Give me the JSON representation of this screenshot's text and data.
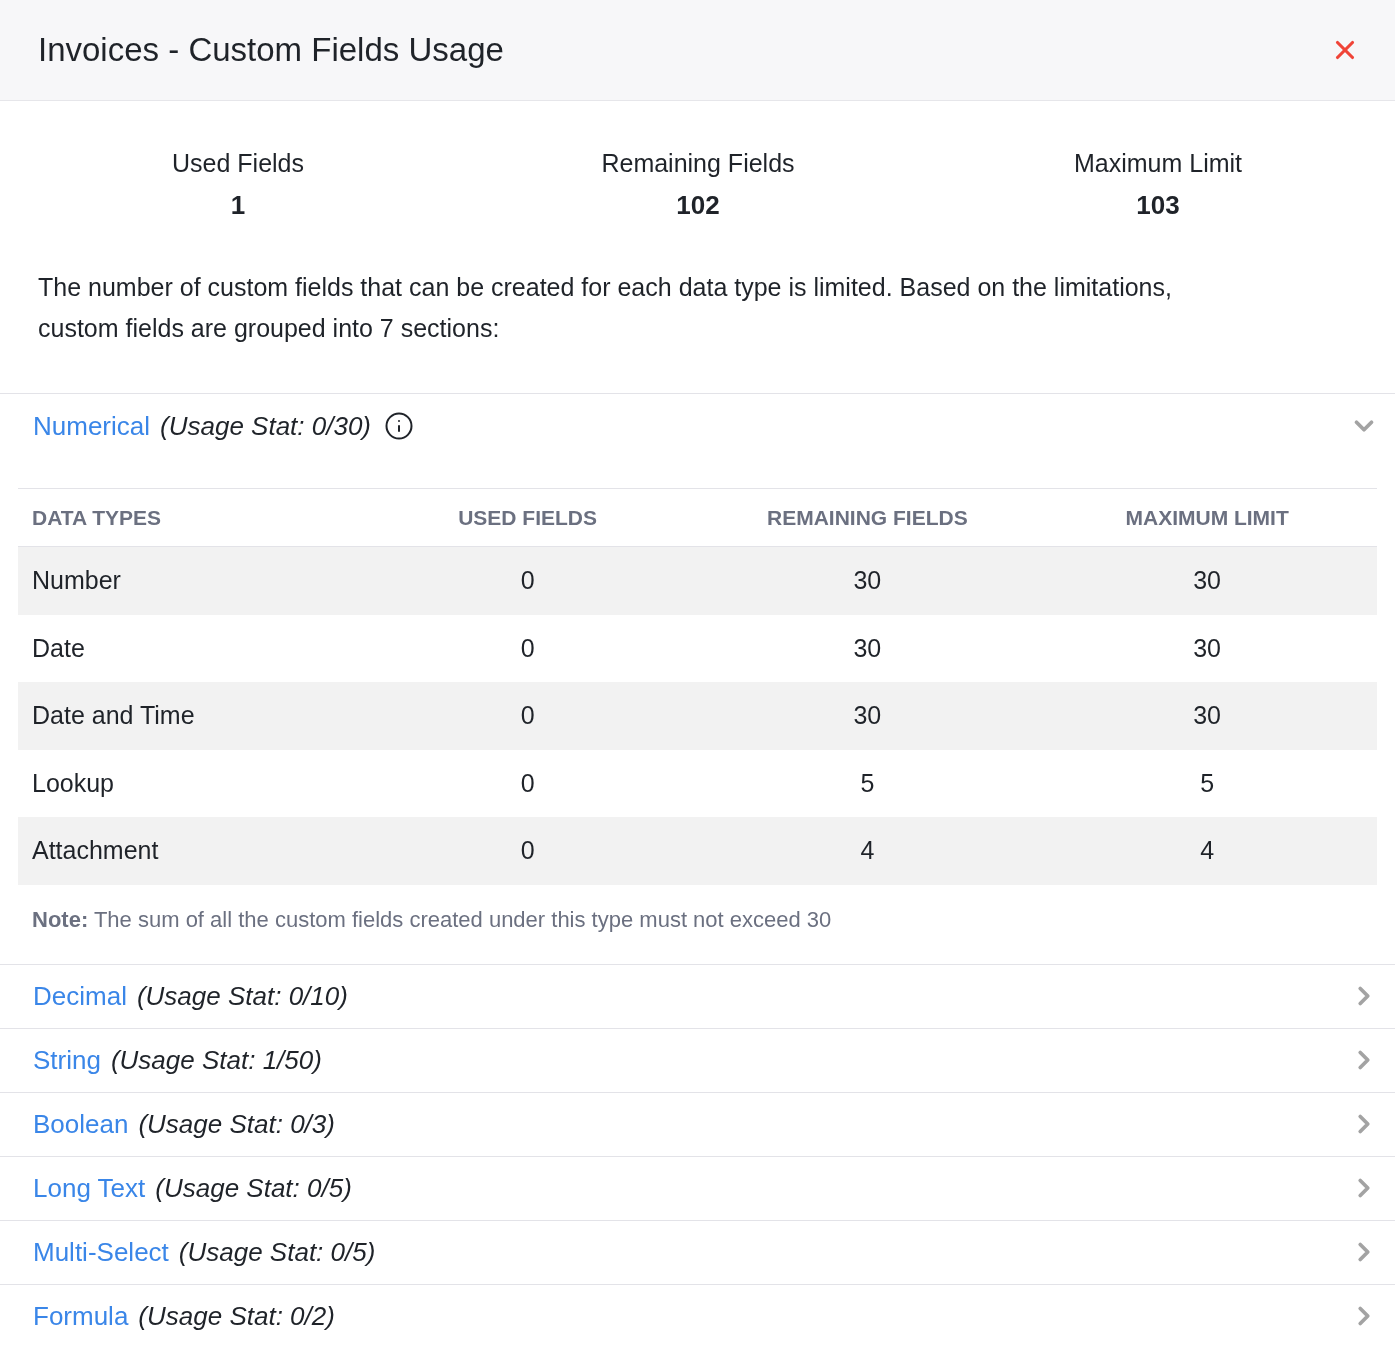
{
  "window": {
    "title": "Invoices - Custom Fields Usage"
  },
  "stats": [
    {
      "label": "Used Fields",
      "value": "1"
    },
    {
      "label": "Remaining Fields",
      "value": "102"
    },
    {
      "label": "Maximum Limit",
      "value": "103"
    }
  ],
  "description": "The number of custom fields that can be created for each data type is limited. Based on the limitations, custom fields are grouped into 7 sections:",
  "sections": [
    {
      "name": "Numerical",
      "stat": "(Usage Stat: 0/30)",
      "info_icon": true,
      "expanded": true,
      "table": {
        "columns": [
          "DATA TYPES",
          "USED FIELDS",
          "REMAINING FIELDS",
          "MAXIMUM LIMIT"
        ],
        "rows": [
          [
            "Number",
            "0",
            "30",
            "30"
          ],
          [
            "Date",
            "0",
            "30",
            "30"
          ],
          [
            "Date and Time",
            "0",
            "30",
            "30"
          ],
          [
            "Lookup",
            "0",
            "5",
            "5"
          ],
          [
            "Attachment",
            "0",
            "4",
            "4"
          ]
        ]
      },
      "note": "**Note:** The sum of all the custom fields created under this type must not exceed 30"
    },
    {
      "name": "Decimal",
      "stat": "(Usage Stat: 0/10)",
      "info_icon": false,
      "expanded": false
    },
    {
      "name": "String",
      "stat": "(Usage Stat: 1/50)",
      "info_icon": false,
      "expanded": false
    },
    {
      "name": "Boolean",
      "stat": "(Usage Stat: 0/3)",
      "info_icon": false,
      "expanded": false
    },
    {
      "name": "Long Text",
      "stat": "(Usage Stat: 0/5)",
      "info_icon": false,
      "expanded": false
    },
    {
      "name": "Multi-Select",
      "stat": "(Usage Stat: 0/5)",
      "info_icon": false,
      "expanded": false
    },
    {
      "name": "Formula",
      "stat": "(Usage Stat: 0/2)",
      "info_icon": false,
      "expanded": false
    }
  ]
}
